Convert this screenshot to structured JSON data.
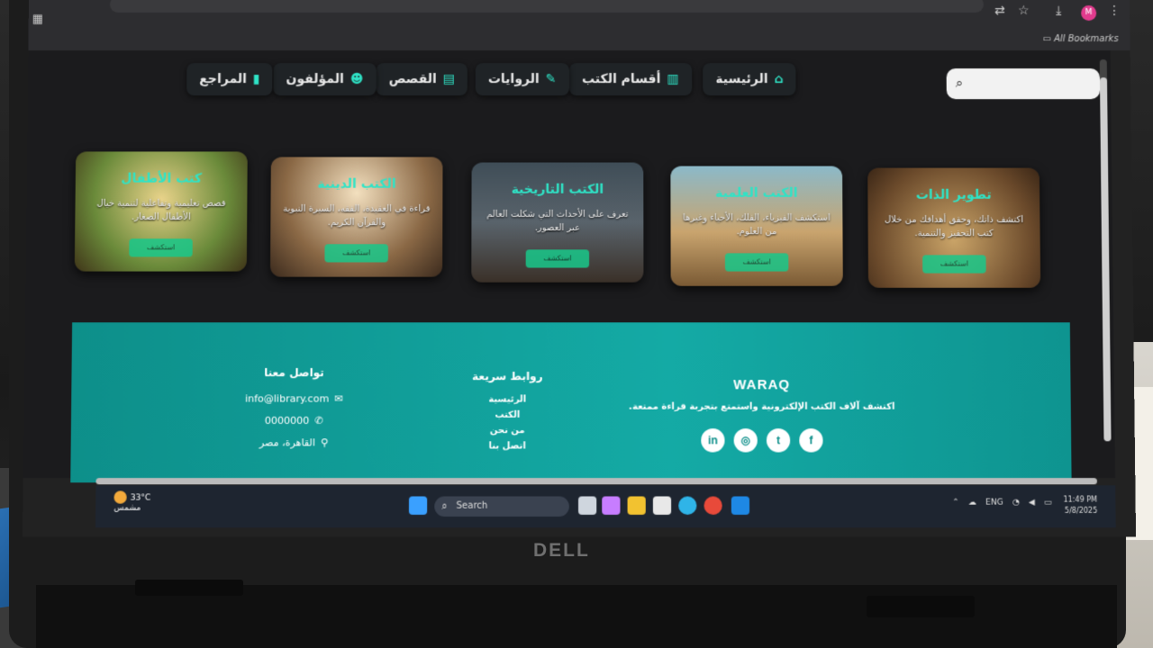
{
  "browser": {
    "bookmarks_label": "All Bookmarks",
    "avatar_initial": "M"
  },
  "nav": {
    "items": [
      {
        "label": "الرئيسية",
        "icon": "home-icon"
      },
      {
        "label": "أقسام الكتب",
        "icon": "book-open-icon"
      },
      {
        "label": "الروايات",
        "icon": "feather-icon"
      },
      {
        "label": "القصص",
        "icon": "scroll-icon"
      },
      {
        "label": "المؤلفون",
        "icon": "users-icon"
      },
      {
        "label": "المراجع",
        "icon": "clipboard-icon"
      }
    ],
    "search_placeholder": "بحث"
  },
  "cards": [
    {
      "title": "تطوير الذات",
      "desc": "اكتشف ذاتك، وحقق أهدافك من خلال كتب التحفيز والتنمية.",
      "button": "استكشف"
    },
    {
      "title": "الكتب العلمية",
      "desc": "استكشف الفيزياء، الفلك، الأحياء وغيرها من العلوم.",
      "button": "استكشف"
    },
    {
      "title": "الكتب التاريخية",
      "desc": "تعرف على الأحداث التي شكلت العالم عبر العصور.",
      "button": "استكشف"
    },
    {
      "title": "الكتب الدينية",
      "desc": "قراءة في العقيدة، الفقه، السيرة النبوية والقرآن الكريم.",
      "button": "استكشف"
    },
    {
      "title": "كتب الأطفال",
      "desc": "قصص تعليمية وتفاعلية لتنمية خيال الأطفال الصغار.",
      "button": "استكشف"
    }
  ],
  "footer": {
    "brand": "WARAQ",
    "tagline": "اكتشف آلاف الكتب الإلكترونية واستمتع بتجربة قراءة ممتعة.",
    "quick_links_title": "روابط سريعة",
    "quick_links": [
      "الرئيسية",
      "الكتب",
      "من نحن",
      "اتصل بنا"
    ],
    "contact_title": "تواصل معنا",
    "email": "info@library.com",
    "phone": "0000000",
    "address": "القاهرة، مصر",
    "socials": [
      "in",
      "◎",
      "t",
      "f"
    ]
  },
  "taskbar": {
    "temperature": "33°C",
    "weather_label": "مشمس",
    "search_label": "Search",
    "language": "ENG",
    "time": "11:49 PM",
    "date": "5/8/2025"
  },
  "device": {
    "brand": "DELL"
  }
}
